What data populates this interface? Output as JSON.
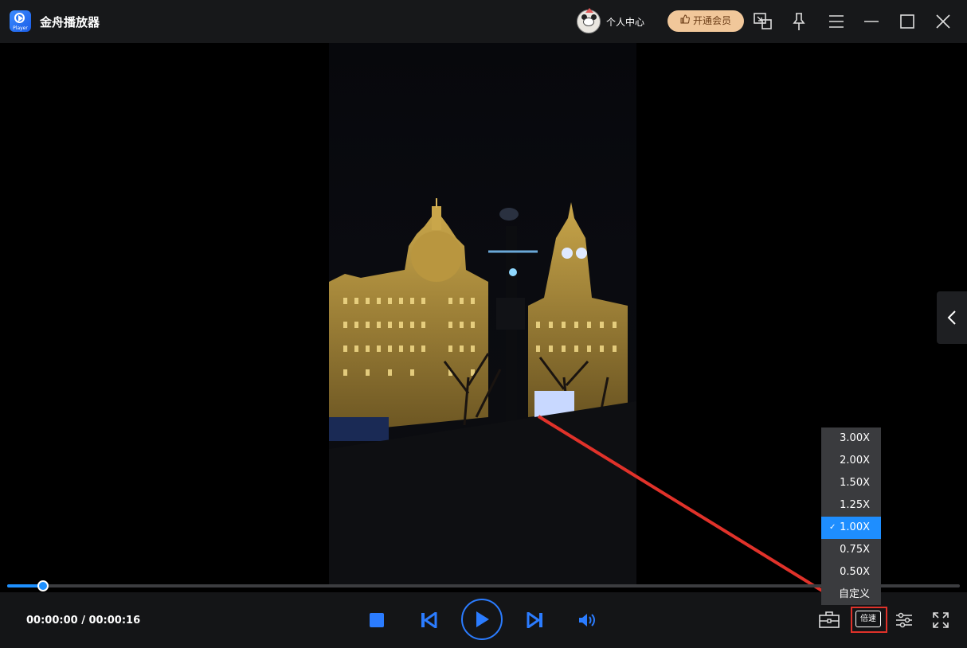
{
  "app": {
    "title": "金舟播放器",
    "logo_text": "Player"
  },
  "header": {
    "user_center": "个人中心",
    "vip_button": "开通会员",
    "icons": [
      "mini-mode-icon",
      "pin-icon",
      "menu-icon",
      "minimize-icon",
      "maximize-icon",
      "close-icon"
    ]
  },
  "player": {
    "time_display": "00:00:00 / 00:00:16",
    "progress": 0.038
  },
  "speed_menu": {
    "items": [
      "3.00X",
      "2.00X",
      "1.50X",
      "1.25X",
      "1.00X",
      "0.75X",
      "0.50X",
      "自定义"
    ],
    "selected": "1.00X",
    "check_mark": "✓",
    "button_label": "倍速"
  },
  "colors": {
    "accent": "#1e8eff",
    "vip_bg": "#f1c79a",
    "annotation": "#e0322a"
  }
}
